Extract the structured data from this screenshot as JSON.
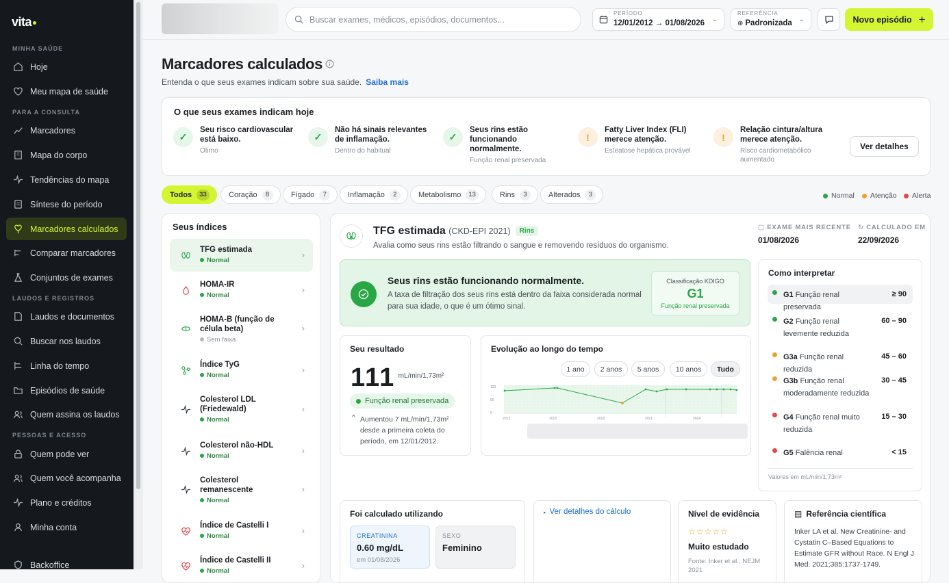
{
  "brand": {
    "name": "vita"
  },
  "sidebar": {
    "sections": [
      "MINHA SAÚDE",
      "PARA A CONSULTA",
      "LAUDOS E REGISTROS",
      "PESSOAS E ACESSO"
    ],
    "items": [
      {
        "label": "Hoje",
        "icon": "home-icon"
      },
      {
        "label": "Meu mapa de saúde",
        "icon": "heart-map-icon"
      },
      {
        "label": "Marcadores",
        "icon": "chart-line-icon"
      },
      {
        "label": "Mapa do corpo",
        "icon": "building-icon"
      },
      {
        "label": "Tendências do mapa",
        "icon": "pulse-icon"
      },
      {
        "label": "Síntese do período",
        "icon": "document-icon"
      },
      {
        "label": "Marcadores calculados",
        "icon": "heart-balloon-icon"
      },
      {
        "label": "Comparar marcadores",
        "icon": "compare-icon"
      },
      {
        "label": "Conjuntos de exames",
        "icon": "flask-icon"
      },
      {
        "label": "Laudos e documentos",
        "icon": "file-icon"
      },
      {
        "label": "Buscar nos laudos",
        "icon": "search-icon"
      },
      {
        "label": "Linha do tempo",
        "icon": "timeline-icon"
      },
      {
        "label": "Episódios de saúde",
        "icon": "folder-icon"
      },
      {
        "label": "Quem assina os laudos",
        "icon": "users-icon"
      },
      {
        "label": "Quem pode ver",
        "icon": "lock-icon"
      },
      {
        "label": "Quem você acompanha",
        "icon": "users-icon"
      },
      {
        "label": "Plano e créditos",
        "icon": "pulse-icon"
      },
      {
        "label": "Minha conta",
        "icon": "user-icon"
      },
      {
        "label": "Backoffice",
        "icon": "shield-icon"
      }
    ]
  },
  "topbar": {
    "search_placeholder": "Buscar exames, médicos, episódios, documentos...",
    "period_label": "PERÍODO",
    "period_value": "12/01/2012 → 01/08/2026",
    "reference_label": "REFERÊNCIA",
    "reference_value": "Padronizada",
    "new_button": "Novo episódio"
  },
  "page": {
    "title": "Marcadores calculados",
    "subtitle": "Entenda o que seus exames indicam sobre sua saúde.",
    "learn_more": "Saiba mais"
  },
  "summary": {
    "title": "O que seus exames indicam hoje",
    "details_button": "Ver detalhes",
    "items": [
      {
        "status": "ok",
        "title": "Seu risco cardiovascular está baixo.",
        "sub": "Ótimo"
      },
      {
        "status": "ok",
        "title": "Não há sinais relevantes de inflamação.",
        "sub": "Dentro do habitual"
      },
      {
        "status": "ok",
        "title": "Seus rins estão funcionando normalmente.",
        "sub": "Função renal preservada"
      },
      {
        "status": "warn",
        "title": "Fatty Liver Index (FLI) merece atenção.",
        "sub": "Esteatose hepática provável"
      },
      {
        "status": "warn",
        "title": "Relação cintura/altura merece atenção.",
        "sub": "Risco cardiometabólico aumentado"
      }
    ]
  },
  "filters": [
    {
      "label": "Todos",
      "count": "33"
    },
    {
      "label": "Coração",
      "count": "8"
    },
    {
      "label": "Fígado",
      "count": "7"
    },
    {
      "label": "Inflamação",
      "count": "2"
    },
    {
      "label": "Metabolismo",
      "count": "13"
    },
    {
      "label": "Rins",
      "count": "3"
    },
    {
      "label": "Alterados",
      "count": "3"
    }
  ],
  "legend": [
    {
      "label": "Normal",
      "color": "#2aa54a"
    },
    {
      "label": "Atenção",
      "color": "#f0a030"
    },
    {
      "label": "Alerta",
      "color": "#e5484d"
    }
  ],
  "indices": {
    "title": "Seus índices",
    "items": [
      {
        "name": "TFG estimada",
        "status": "Normal",
        "icon": "kidney-icon"
      },
      {
        "name": "HOMA-IR",
        "status": "Normal",
        "icon": "drop-icon"
      },
      {
        "name": "HOMA-B (função de célula beta)",
        "status": "Sem faixa",
        "icon": "pill-icon"
      },
      {
        "name": "Índice TyG",
        "status": "Normal",
        "icon": "molecule-icon"
      },
      {
        "name": "Colesterol LDL (Friedewald)",
        "status": "Normal",
        "icon": "pulse-icon"
      },
      {
        "name": "Colesterol não-HDL",
        "status": "Normal",
        "icon": "pulse-icon"
      },
      {
        "name": "Colesterol remanescente",
        "status": "Normal",
        "icon": "pulse-icon"
      },
      {
        "name": "Índice de Castelli I",
        "status": "Normal",
        "icon": "heart-pulse-icon"
      },
      {
        "name": "Índice de Castelli II",
        "status": "Normal",
        "icon": "heart-pulse-icon"
      }
    ]
  },
  "detail": {
    "name": "TFG estimada",
    "formula": "(CKD-EPI 2021)",
    "tag": "Rins",
    "description": "Avalia como seus rins estão filtrando o sangue e removendo resíduos do organismo.",
    "recent_label": "EXAME MAIS RECENTE",
    "recent_value": "01/08/2026",
    "calc_label": "CALCULADO EM",
    "calc_value": "22/09/2026",
    "good_title": "Seus rins estão funcionando normalmente.",
    "good_text": "A taxa de filtração dos seus rins está dentro da faixa considerada normal para sua idade, o que é um ótimo sinal.",
    "kdigo_label": "Classificação KDIGO",
    "kdigo_value": "G1",
    "kdigo_sub": "Função renal preservada",
    "result_title": "Seu resultado",
    "result_value": "111",
    "result_unit": "mL/min/1,73m²",
    "result_badge": "Função renal preservada",
    "result_note": "Aumentou 7 mL/min/1,73m² desde a primeira coleta do período, em 12/01/2012.",
    "evolution_title": "Evolução ao longo do tempo",
    "ranges": [
      "1 ano",
      "2 anos",
      "5 anos",
      "10 anos",
      "Tudo"
    ],
    "chart_y_ticks": [
      "120",
      "60",
      "0"
    ],
    "chart_x_ticks": [
      "2012",
      "2015",
      "2018",
      "2021",
      "2024"
    ],
    "interp_title": "Como interpretar",
    "interp": [
      {
        "code": "G1",
        "label": "Função renal preservada",
        "range": "≥ 90",
        "color": "#2aa54a"
      },
      {
        "code": "G2",
        "label": "Função renal levemente reduzida",
        "range": "60 – 90",
        "color": "#2aa54a"
      },
      {
        "code": "G3a",
        "label": "Função renal reduzida",
        "range": "45 – 60",
        "color": "#f0a030"
      },
      {
        "code": "G3b",
        "label": "Função renal moderadamente reduzida",
        "range": "30 – 45",
        "color": "#f0a030"
      },
      {
        "code": "G4",
        "label": "Função renal muito reduzida",
        "range": "15 – 30",
        "color": "#e5484d"
      },
      {
        "code": "G5",
        "label": "Falência renal",
        "range": "< 15",
        "color": "#e5484d"
      }
    ],
    "interp_note": "Valores em mL/min/1,73m²",
    "calc_with_title": "Foi calculado utilizando",
    "field1_label": "CREATININA",
    "field1_value": "0.60 mg/dL",
    "field1_sub": "em 01/08/2026",
    "field2_label": "SEXO",
    "field2_value": "Feminino",
    "calc_details_link": "Ver detalhes do cálculo",
    "evidence_title": "Nível de evidência",
    "evidence_value": "Muito estudado",
    "evidence_source": "Fonte: Inker et al., NEJM 2021",
    "ref_title": "Referência científica",
    "ref_text": "Inker LA et al. New Creatinine- and Cystatin C–Based Equations to Estimate GFR without Race. N Engl J Med. 2021;385:1737-1749."
  }
}
